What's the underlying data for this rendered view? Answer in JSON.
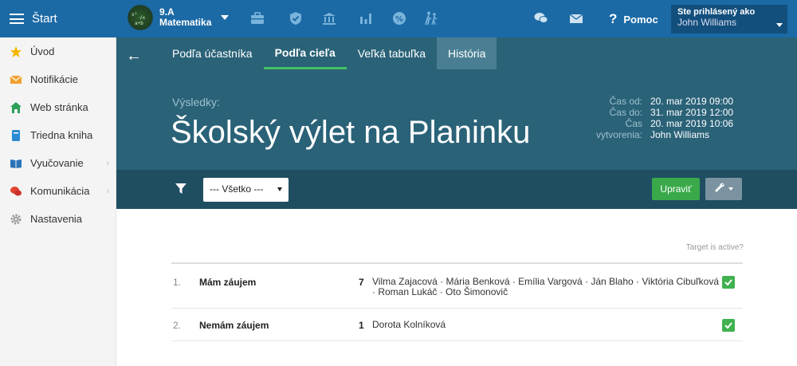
{
  "topbar": {
    "start_label": "Štart",
    "class_name": "9.A",
    "subject": "Matematika",
    "help_label": "Pomoc",
    "user_caption": "Ste prihlásený ako",
    "user_name": "John Williams"
  },
  "sidebar": {
    "items": [
      {
        "label": "Úvod",
        "icon": "star-icon"
      },
      {
        "label": "Notifikácie",
        "icon": "envelope-icon"
      },
      {
        "label": "Web stránka",
        "icon": "home-icon"
      },
      {
        "label": "Triedna kniha",
        "icon": "book-icon"
      },
      {
        "label": "Vyučovanie",
        "icon": "open-book-icon",
        "chevron": "›"
      },
      {
        "label": "Komunikácia",
        "icon": "chat-icon",
        "chevron": "›"
      },
      {
        "label": "Nastavenia",
        "icon": "gear-icon"
      }
    ]
  },
  "tabs": [
    {
      "label": "Podľa účastníka"
    },
    {
      "label": "Podľa cieľa"
    },
    {
      "label": "Veľká tabuľka"
    },
    {
      "label": "História"
    }
  ],
  "header": {
    "results_label": "Výsledky:",
    "title": "Školský výlet na Planinku",
    "meta": [
      {
        "k": "Čas od:",
        "v": "20. mar 2019 09:00"
      },
      {
        "k": "Čas do:",
        "v": "31. mar 2019 12:00"
      },
      {
        "k": "Čas",
        "v": "20. mar 2019 10:06"
      },
      {
        "k": "vytvorenia:",
        "v": "John Williams"
      }
    ]
  },
  "filter": {
    "selected": "--- Všetko ---",
    "edit_label": "Upraviť"
  },
  "content": {
    "target_active_label": "Target is active?",
    "results": [
      {
        "num": "1.",
        "name": "Mám záujem",
        "count": "7",
        "people_line1": "Vilma Zajacová · Mária Benková · Emília Vargová · Ján Blaho · Viktória Cibuľková",
        "people_line2": "· Roman Lukáč · Oto Šimonovič"
      },
      {
        "num": "2.",
        "name": "Nemám záujem",
        "count": "1",
        "people_line1": "Dorota Kolníková",
        "people_line2": ""
      }
    ]
  },
  "colors": {
    "topbar": "#1b6aa5",
    "header": "#2a6278",
    "filterbar": "#1f4e61",
    "accent_green": "#39a94a"
  }
}
